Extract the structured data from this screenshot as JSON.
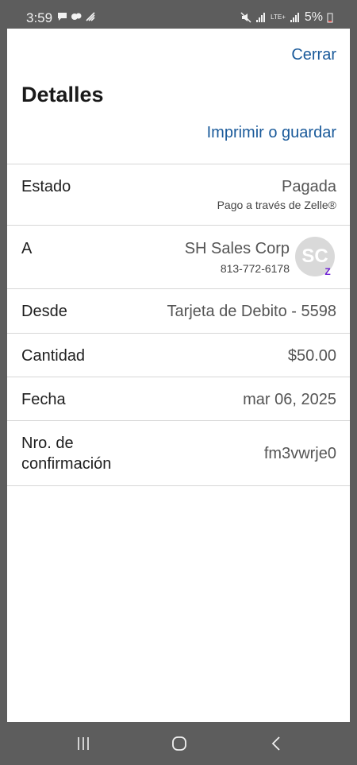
{
  "status_bar": {
    "time": "3:59",
    "battery": "5%",
    "network": "LTE+"
  },
  "header": {
    "close_label": "Cerrar",
    "title": "Detalles",
    "print_label": "Imprimir o guardar"
  },
  "details": {
    "estado": {
      "label": "Estado",
      "value": "Pagada",
      "sub": "Pago a través de Zelle®"
    },
    "a": {
      "label": "A",
      "value": "SH Sales Corp",
      "phone": "813-772-6178",
      "avatar_initials": "SC",
      "badge": "Z"
    },
    "desde": {
      "label": "Desde",
      "value": "Tarjeta de Debito - 5598"
    },
    "cantidad": {
      "label": "Cantidad",
      "value": "$50.00"
    },
    "fecha": {
      "label": "Fecha",
      "value": "mar 06, 2025"
    },
    "confirmacion": {
      "label_line1": "Nro. de",
      "label_line2": "confirmación",
      "value": "fm3vwrje0"
    }
  },
  "icons": {
    "nav_recents": "recents-icon",
    "nav_home": "home-icon",
    "nav_back": "back-icon"
  },
  "colors": {
    "link": "#1a5a9a",
    "zelle": "#6d1ed4"
  }
}
